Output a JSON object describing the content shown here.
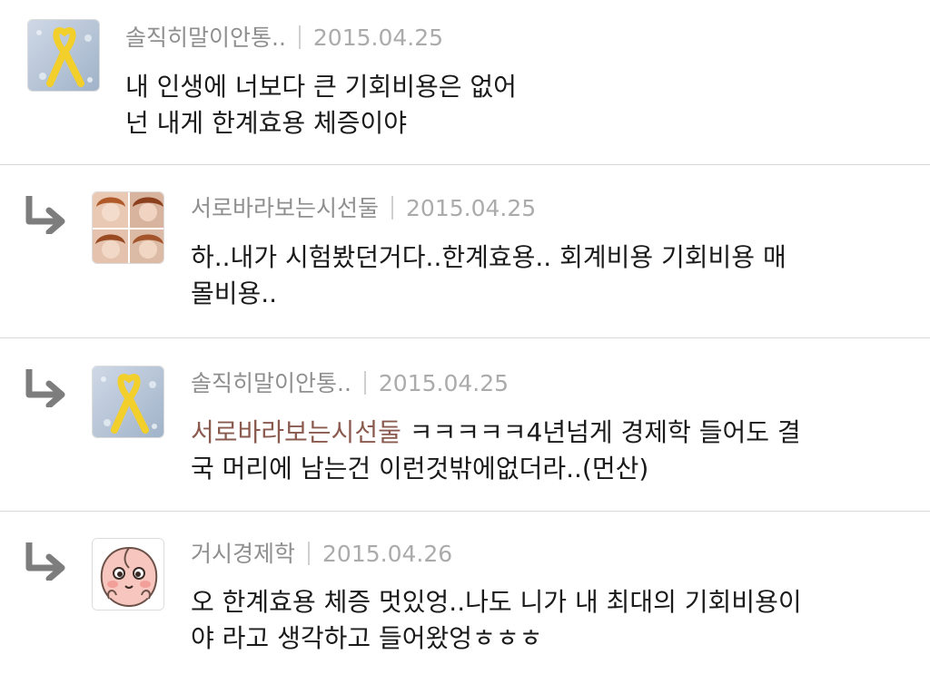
{
  "colors": {
    "divider": "#d7d7d7",
    "author": "#8f8f8f",
    "date": "#ababab",
    "body_text": "#1a1a1a",
    "mention": "#8a5a4f",
    "reply_arrow": "#7d7d7d"
  },
  "comments": [
    {
      "author": "솔직히말이안통..",
      "date": "2015.04.25",
      "avatar_icon": "yellow-ribbon-avatar",
      "lines": [
        "내 인생에 너보다 큰 기회비용은 없어",
        "넌 내게 한계효용 체증이야"
      ]
    },
    {
      "author": "서로바라보는시선둘",
      "date": "2015.04.25",
      "avatar_icon": "photo-grid-avatar",
      "reply_icon": "reply-arrow-icon",
      "lines": [
        "하..내가 시험봤던거다..한계효용.. 회계비용 기회비용 매",
        "몰비용.."
      ]
    },
    {
      "author": "솔직히말이안통..",
      "date": "2015.04.25",
      "avatar_icon": "yellow-ribbon-avatar",
      "reply_icon": "reply-arrow-icon",
      "mention": "서로바라보는시선둘",
      "lines": [
        " ㅋㅋㅋㅋㅋ4년넘게 경제학 들어도 결",
        "국 머리에 남는건 이런것밖에없더라..(먼산)"
      ]
    },
    {
      "author": "거시경제학",
      "date": "2015.04.26",
      "avatar_icon": "peach-character-avatar",
      "reply_icon": "reply-arrow-icon",
      "lines": [
        "오 한계효용 체증 멋있엉..나도 니가 내 최대의 기회비용이",
        "야 라고 생각하고 들어왔엉ㅎㅎㅎ"
      ]
    }
  ]
}
